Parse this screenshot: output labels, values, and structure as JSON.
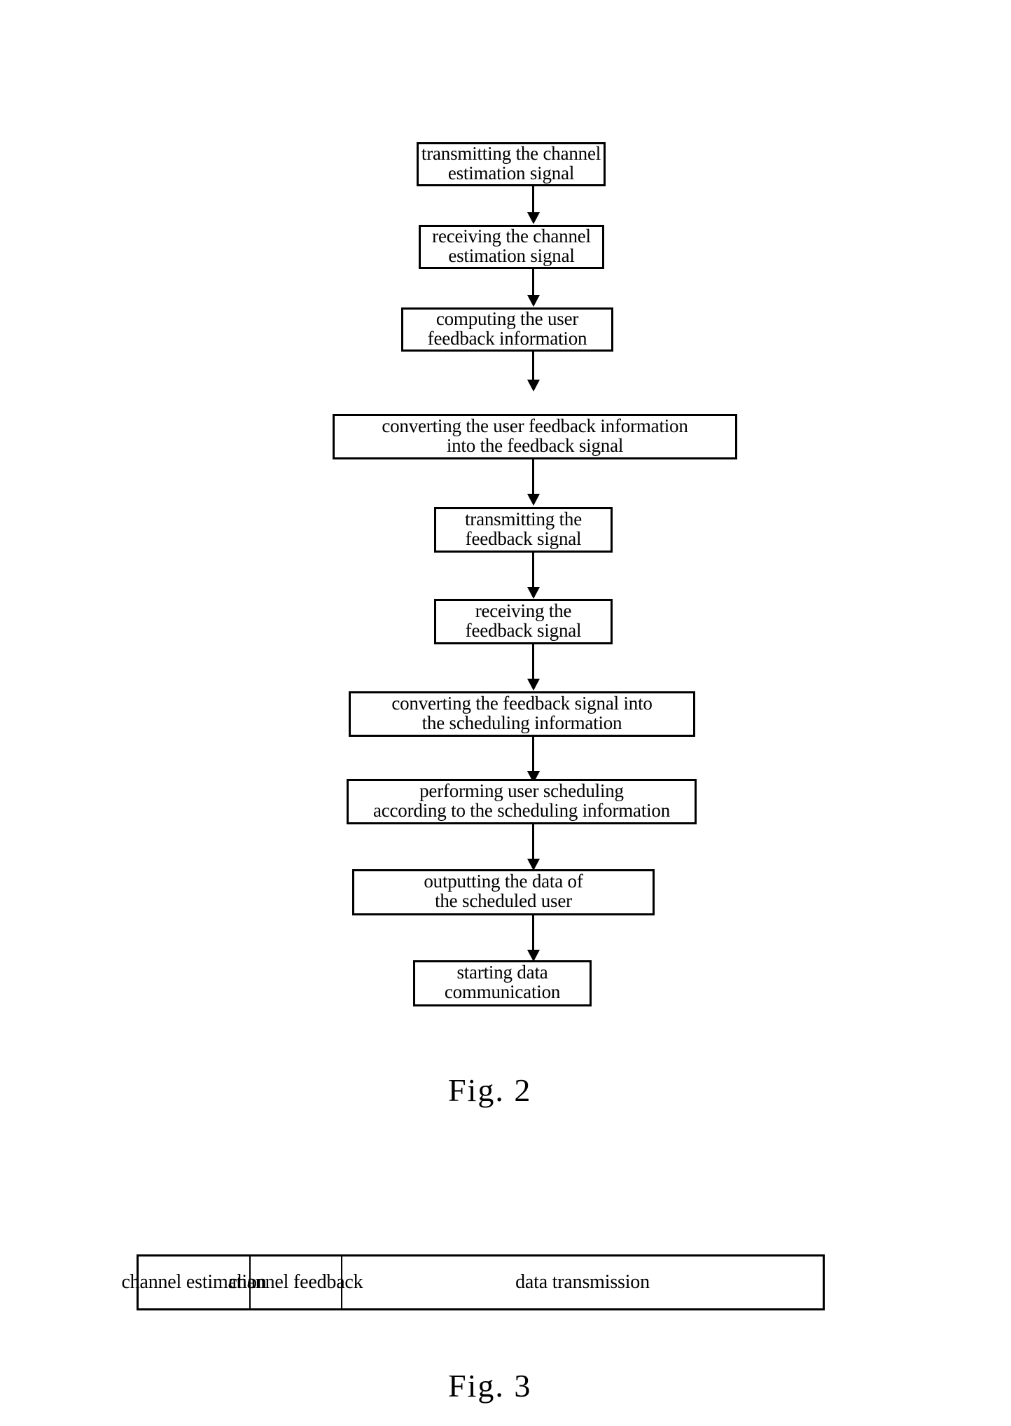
{
  "figure2": {
    "caption": "Fig.  2",
    "steps": [
      {
        "name": "transmitting-channel-estimation-signal",
        "line1": "transmitting the channel",
        "line2": "estimation signal"
      },
      {
        "name": "receiving-channel-estimation-signal",
        "line1": "receiving the channel",
        "line2": "estimation signal"
      },
      {
        "name": "computing-user-feedback-information",
        "line1": "computing the user",
        "line2": "feedback information"
      },
      {
        "name": "converting-user-feedback-information",
        "line1": "converting the user feedback information",
        "line2": "into the feedback signal"
      },
      {
        "name": "transmitting-feedback-signal",
        "line1": "transmitting the",
        "line2": "feedback signal"
      },
      {
        "name": "receiving-feedback-signal",
        "line1": "receiving the",
        "line2": "feedback signal"
      },
      {
        "name": "converting-feedback-signal",
        "line1": "converting the feedback signal into",
        "line2": "the scheduling information"
      },
      {
        "name": "performing-user-scheduling",
        "line1": "performing user scheduling",
        "line2": "according to the scheduling information"
      },
      {
        "name": "outputting-scheduled-user-data",
        "line1": "outputting the data of",
        "line2": "the scheduled user"
      },
      {
        "name": "starting-data-communication",
        "line1": "starting data",
        "line2": "communication"
      }
    ]
  },
  "figure3": {
    "caption": "Fig.  3",
    "timeline": [
      {
        "name": "channel-estimation",
        "label": "channel estimation"
      },
      {
        "name": "channel-feedback",
        "label": "channel feedback"
      },
      {
        "name": "data-transmission",
        "label": "data transmission"
      }
    ]
  }
}
